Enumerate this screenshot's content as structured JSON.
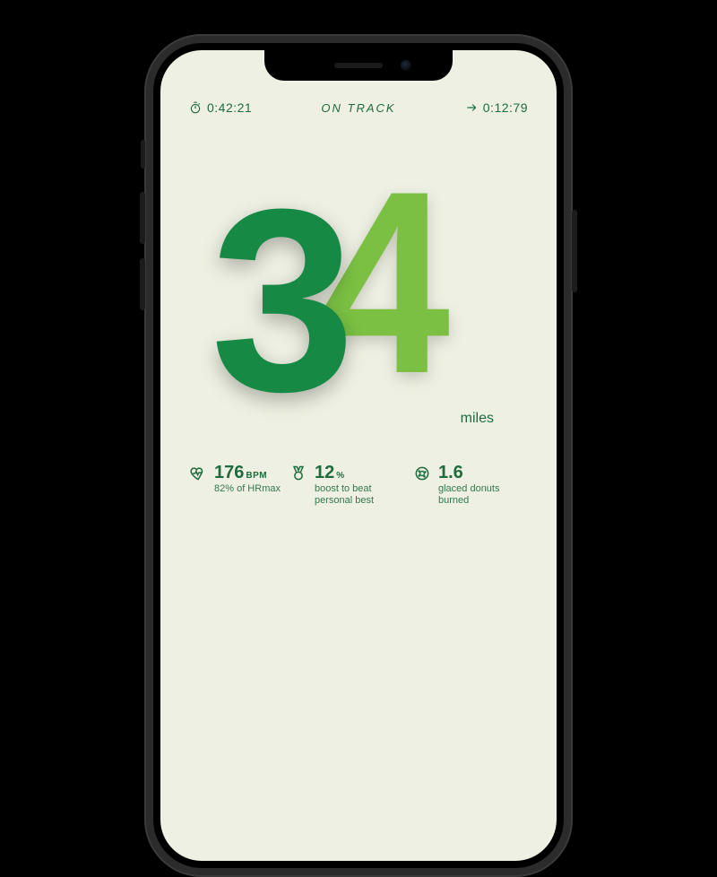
{
  "top": {
    "elapsed": "0:42:21",
    "status": "ON TRACK",
    "remaining": "0:12:79"
  },
  "distance": {
    "front_digit": "3",
    "back_digit": "4",
    "unit": "miles"
  },
  "stats": {
    "hr": {
      "value": "176",
      "unit": "BPM",
      "sub": "82% of HRmax"
    },
    "boost": {
      "value": "12",
      "unit": "%",
      "sub": "boost to\nbeat personal best"
    },
    "donuts": {
      "value": "1.6",
      "sub": "glaced\ndonuts burned"
    }
  },
  "colors": {
    "bg": "#eef0e3",
    "fg": "#1f6b3e",
    "digit_front": "#168a45",
    "digit_back": "#7bc043"
  }
}
